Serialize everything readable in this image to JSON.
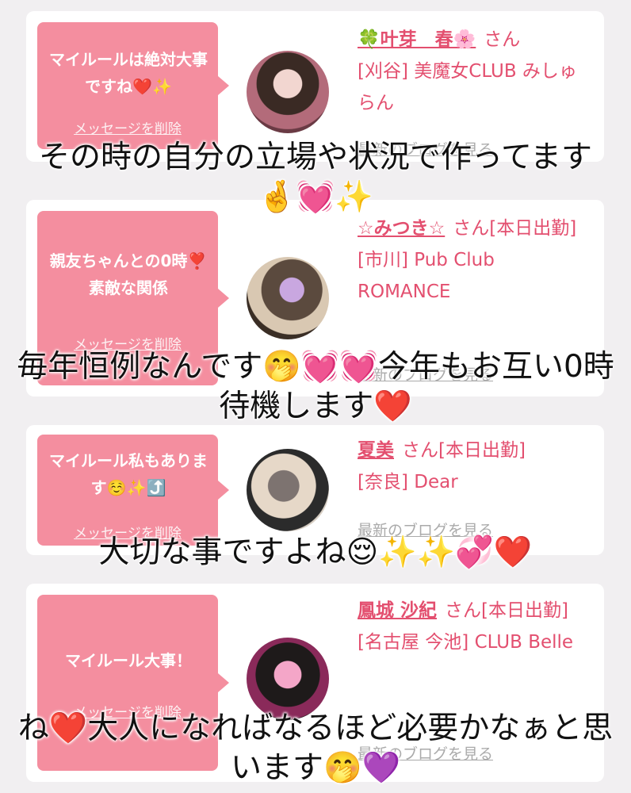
{
  "cards": [
    {
      "message": "マイルールは絶対大事ですね❤️✨",
      "delete_label": "メッセージを削除",
      "name": "🍀叶芽　春🌸",
      "suffix": "さん",
      "store": "[刈谷] 美魔女CLUB みしゅらん",
      "blog_label": "最新のブログを見る"
    },
    {
      "message": "親友ちゃんとの0時❣️素敵な関係",
      "delete_label": "メッセージを削除",
      "name": "☆みつき☆",
      "suffix": "さん[本日出勤]",
      "store": "[市川] Pub Club ROMANCE",
      "blog_label": "最新のブログを見る"
    },
    {
      "message": "マイルール私もあります☺️✨⤴️",
      "delete_label": "メッセージを削除",
      "name": "夏美",
      "suffix": "さん[本日出勤]",
      "store": "[奈良] Dear",
      "blog_label": "最新のブログを見る"
    },
    {
      "message": "マイルール大事！",
      "delete_label": "メッセージを削除",
      "name": "鳳城 沙紀",
      "suffix": "さん[本日出勤]",
      "store": "[名古屋 今池] CLUB Belle",
      "blog_label": "最新のブログを見る"
    }
  ],
  "overlays": [
    "その時の自分の立場や状況で作ってます🤞💓✨",
    "毎年恒例なんです🤭💓💓今年もお互い0時待機します❤️",
    "大切な事ですよね😌✨✨💞❤️",
    "ね❤️大人になればなるほど必要かなぁと思います🤭💜"
  ],
  "colors": {
    "bubble": "#f48e9f",
    "name_pink": "#e34f6f",
    "background": "#f1eff1"
  }
}
